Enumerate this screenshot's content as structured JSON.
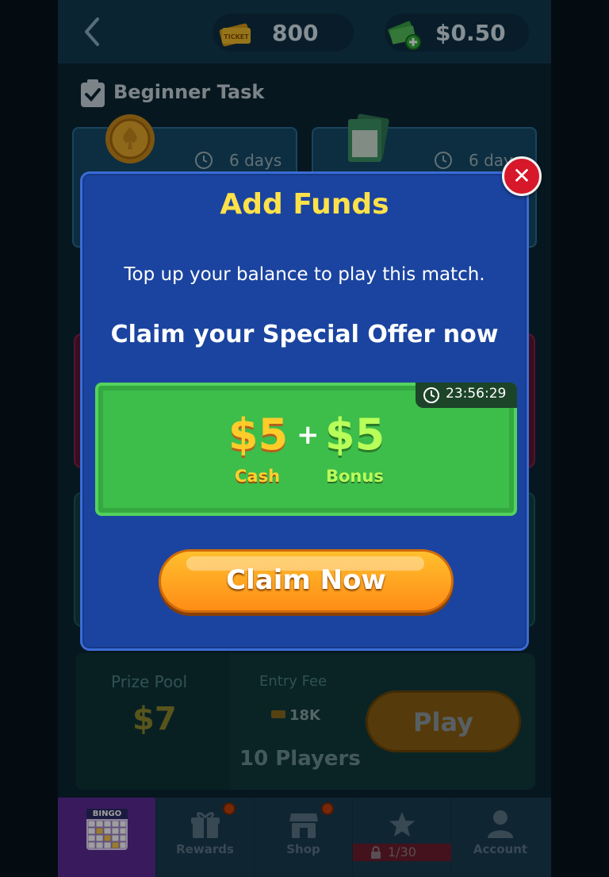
{
  "header": {
    "tickets": "800",
    "cash": "$0.50"
  },
  "tasks": {
    "title": "Beginner Task",
    "card_a_days": "6 days",
    "card_b_days": "6 days"
  },
  "match": {
    "prize_label": "Prize Pool",
    "prize_value": "$7",
    "fee_label": "Entry Fee",
    "fee_value": "18K",
    "players": "10 Players",
    "play_label": "Play"
  },
  "nav": {
    "items": [
      {
        "label": ""
      },
      {
        "label": "Rewards"
      },
      {
        "label": "Shop"
      },
      {
        "label": ""
      },
      {
        "label": "Account"
      }
    ],
    "bingo_label": "BINGO",
    "progress": "1/30"
  },
  "modal": {
    "title": "Add Funds",
    "subtitle": "Top up your balance to play this match.",
    "offer_heading": "Claim your Special Offer now",
    "timer": "23:56:29",
    "cash_amount": "$5",
    "bonus_amount": "$5",
    "plus": "+",
    "cash_label": "Cash",
    "bonus_label": "Bonus",
    "claim_label": "Claim Now",
    "close_symbol": "✕"
  },
  "colors": {
    "title_yellow": "#ffe14a",
    "modal_blue": "#1b44a0",
    "offer_green": "#3dbd49",
    "claim_orange": "#ff9f1f",
    "close_red": "#d6182a"
  },
  "icons": [
    "back-chevron-icon",
    "ticket-icon",
    "cash-stack-icon",
    "clipboard-check-icon",
    "gold-coin-icon",
    "scratcher-card-icon",
    "clock-icon",
    "close-icon",
    "gift-icon",
    "shop-icon",
    "star-icon",
    "lock-icon",
    "account-icon"
  ]
}
